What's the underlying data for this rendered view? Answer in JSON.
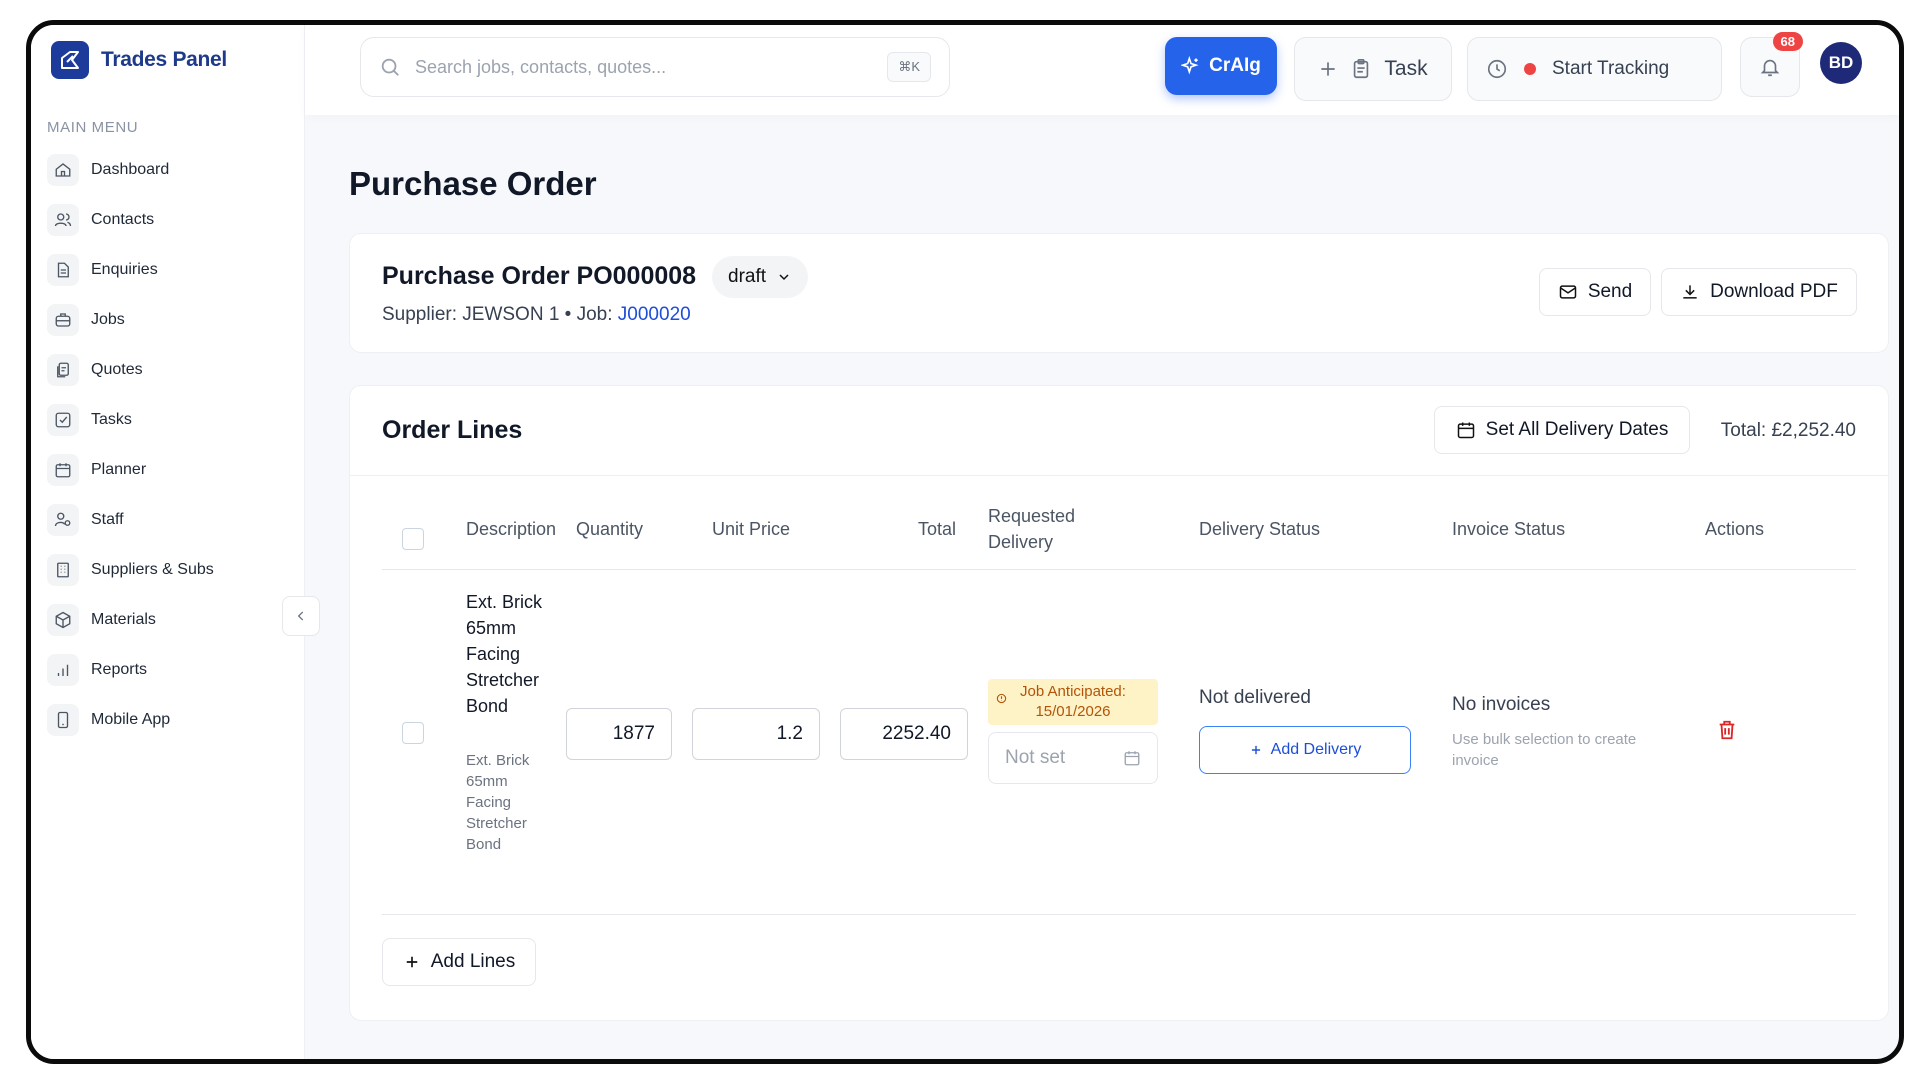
{
  "brand": {
    "name": "Trades Panel"
  },
  "sidebar": {
    "section_title": "MAIN MENU",
    "items": [
      {
        "label": "Dashboard",
        "icon": "home-icon"
      },
      {
        "label": "Contacts",
        "icon": "users-icon"
      },
      {
        "label": "Enquiries",
        "icon": "document-icon"
      },
      {
        "label": "Jobs",
        "icon": "briefcase-icon"
      },
      {
        "label": "Quotes",
        "icon": "quote-icon"
      },
      {
        "label": "Tasks",
        "icon": "checkbox-icon"
      },
      {
        "label": "Planner",
        "icon": "calendar-icon"
      },
      {
        "label": "Staff",
        "icon": "staff-icon"
      },
      {
        "label": "Suppliers & Subs",
        "icon": "building-icon"
      },
      {
        "label": "Materials",
        "icon": "box-icon"
      },
      {
        "label": "Reports",
        "icon": "bar-chart-icon"
      },
      {
        "label": "Mobile App",
        "icon": "smartphone-icon"
      }
    ]
  },
  "topbar": {
    "search_placeholder": "Search jobs, contacts, quotes...",
    "search_shortcut": "⌘K",
    "ai_label": "CrAIg",
    "task_label": "Task",
    "tracking_label": "Start Tracking",
    "notification_count": "68",
    "avatar_initials": "BD"
  },
  "page": {
    "title": "Purchase Order"
  },
  "po": {
    "title": "Purchase Order PO000008",
    "status": "draft",
    "supplier_text": "Supplier: JEWSON 1 • Job: ",
    "job_link": "J000020",
    "send_label": "Send",
    "download_label": "Download PDF"
  },
  "order_lines": {
    "title": "Order Lines",
    "set_dates_label": "Set All Delivery Dates",
    "total": "Total: £2,252.40",
    "columns": {
      "description": "Description",
      "quantity": "Quantity",
      "unit_price": "Unit Price",
      "total": "Total",
      "requested_delivery": "Requested Delivery",
      "delivery_status": "Delivery Status",
      "invoice_status": "Invoice Status",
      "actions": "Actions"
    },
    "rows": [
      {
        "description": "Ext. Brick 65mm Facing Stretcher Bond",
        "description_sub": "Ext. Brick 65mm Facing Stretcher Bond",
        "quantity": "1877",
        "unit_price": "1.2",
        "total": "2252.40",
        "anticipated": "Job Anticipated: 15/01/2026",
        "delivery_date_placeholder": "Not set",
        "delivery_status": "Not delivered",
        "add_delivery_label": "Add Delivery",
        "invoice_status": "No invoices",
        "invoice_hint": "Use bulk selection to create invoice"
      }
    ],
    "add_lines_label": "Add Lines"
  },
  "colors": {
    "primary": "#2563eb",
    "brand": "#1e3a8a",
    "danger": "#ef4444",
    "warning_bg": "#fef3c7",
    "warning_text": "#b45309"
  }
}
